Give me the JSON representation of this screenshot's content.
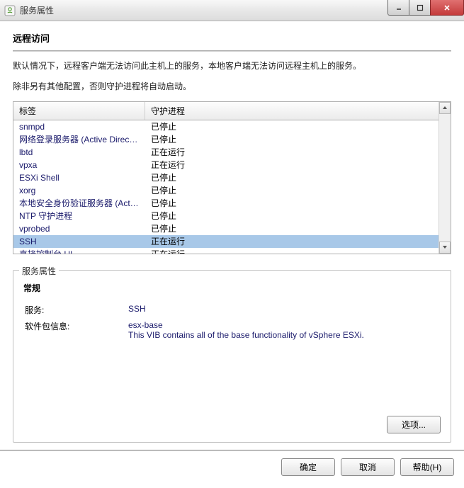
{
  "window": {
    "title": "服务属性"
  },
  "remote": {
    "title": "远程访问",
    "desc1": "默认情况下，远程客户端无法访问此主机上的服务，本地客户端无法访问远程主机上的服务。",
    "desc2": "除非另有其他配置，否则守护进程将自动启动。"
  },
  "table": {
    "col_label": "标签",
    "col_status": "守护进程",
    "selected_index": 8,
    "rows": [
      {
        "label": "snmpd",
        "status": "已停止"
      },
      {
        "label": "网络登录服务器 (Active Directory...",
        "status": "已停止"
      },
      {
        "label": "lbtd",
        "status": "正在运行"
      },
      {
        "label": "vpxa",
        "status": "正在运行"
      },
      {
        "label": "ESXi Shell",
        "status": "已停止"
      },
      {
        "label": "xorg",
        "status": "已停止"
      },
      {
        "label": "本地安全身份验证服务器 (Active...",
        "status": "已停止"
      },
      {
        "label": "NTP 守护进程",
        "status": "已停止"
      },
      {
        "label": "vprobed",
        "status": "已停止"
      },
      {
        "label": "SSH",
        "status": "正在运行"
      },
      {
        "label": "直接控制台 UI",
        "status": "正在运行"
      }
    ]
  },
  "fieldset": {
    "legend": "服务属性",
    "subtitle": "常规",
    "service_label": "服务:",
    "service_value": "SSH",
    "pkg_label": "软件包信息:",
    "pkg_value_line1": "esx-base",
    "pkg_value_line2": "This VIB contains all of the base functionality of vSphere ESXi.",
    "options_btn": "选项..."
  },
  "footer": {
    "ok": "确定",
    "cancel": "取消",
    "help": "帮助(H)"
  }
}
